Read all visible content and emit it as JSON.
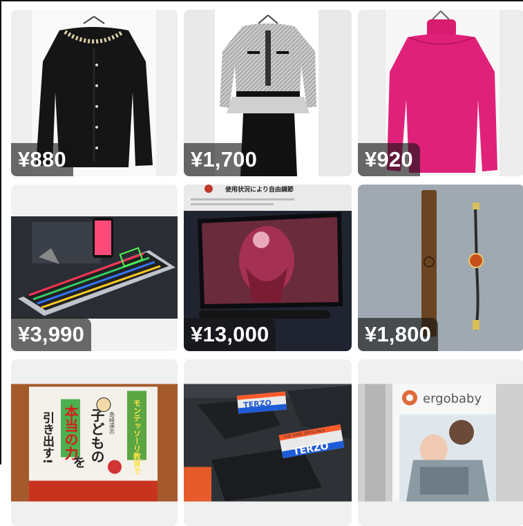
{
  "products": [
    {
      "price": "¥880",
      "item": "black cardigan"
    },
    {
      "price": "¥1,700",
      "item": "tweed peplum dress"
    },
    {
      "price": "¥920",
      "item": "pink turtleneck"
    },
    {
      "price": "¥3,990",
      "item": "rgb gaming keyboard"
    },
    {
      "price": "¥13,000",
      "item": "monitor speaker set"
    },
    {
      "price": "¥1,800",
      "item": "leather bracelets"
    },
    {
      "item": "montessori book"
    },
    {
      "item": "terzo carriers"
    },
    {
      "item": "ergobaby carrier box"
    }
  ],
  "labels": {
    "monitor_headline": "使用状況により自由調節",
    "book_spine_title": "モンテッソーリ教育で",
    "book_title_1": "子どもの",
    "book_title_2": "本当の力",
    "book_title_3": "を",
    "book_title_4": "引き出す!",
    "book_author": "島崎達志",
    "terzo_small": "THE KINS OFFICIALS",
    "terzo_brand": "TERZO",
    "ergobaby_brand": "ergobaby"
  }
}
